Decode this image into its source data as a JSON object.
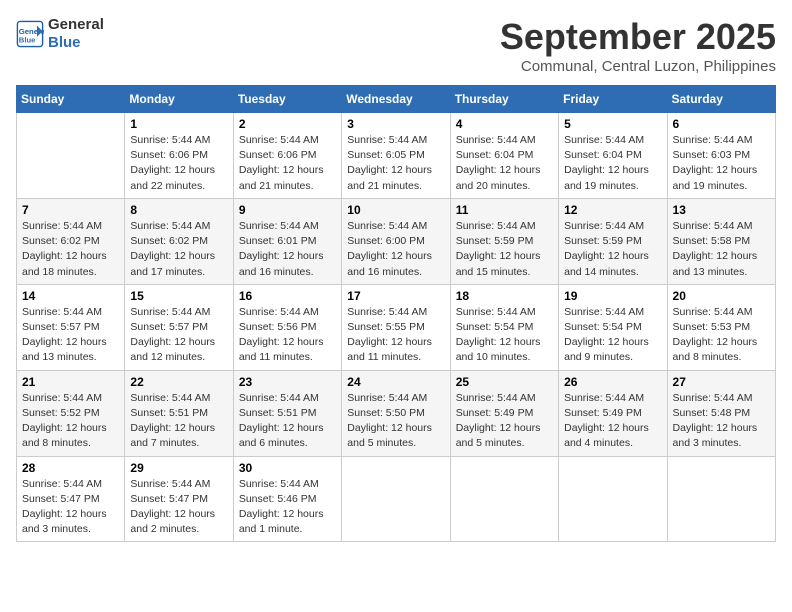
{
  "logo": {
    "text_general": "General",
    "text_blue": "Blue"
  },
  "title": "September 2025",
  "subtitle": "Communal, Central Luzon, Philippines",
  "days_of_week": [
    "Sunday",
    "Monday",
    "Tuesday",
    "Wednesday",
    "Thursday",
    "Friday",
    "Saturday"
  ],
  "weeks": [
    [
      {
        "day": "",
        "info": ""
      },
      {
        "day": "1",
        "info": "Sunrise: 5:44 AM\nSunset: 6:06 PM\nDaylight: 12 hours\nand 22 minutes."
      },
      {
        "day": "2",
        "info": "Sunrise: 5:44 AM\nSunset: 6:06 PM\nDaylight: 12 hours\nand 21 minutes."
      },
      {
        "day": "3",
        "info": "Sunrise: 5:44 AM\nSunset: 6:05 PM\nDaylight: 12 hours\nand 21 minutes."
      },
      {
        "day": "4",
        "info": "Sunrise: 5:44 AM\nSunset: 6:04 PM\nDaylight: 12 hours\nand 20 minutes."
      },
      {
        "day": "5",
        "info": "Sunrise: 5:44 AM\nSunset: 6:04 PM\nDaylight: 12 hours\nand 19 minutes."
      },
      {
        "day": "6",
        "info": "Sunrise: 5:44 AM\nSunset: 6:03 PM\nDaylight: 12 hours\nand 19 minutes."
      }
    ],
    [
      {
        "day": "7",
        "info": "Sunrise: 5:44 AM\nSunset: 6:02 PM\nDaylight: 12 hours\nand 18 minutes."
      },
      {
        "day": "8",
        "info": "Sunrise: 5:44 AM\nSunset: 6:02 PM\nDaylight: 12 hours\nand 17 minutes."
      },
      {
        "day": "9",
        "info": "Sunrise: 5:44 AM\nSunset: 6:01 PM\nDaylight: 12 hours\nand 16 minutes."
      },
      {
        "day": "10",
        "info": "Sunrise: 5:44 AM\nSunset: 6:00 PM\nDaylight: 12 hours\nand 16 minutes."
      },
      {
        "day": "11",
        "info": "Sunrise: 5:44 AM\nSunset: 5:59 PM\nDaylight: 12 hours\nand 15 minutes."
      },
      {
        "day": "12",
        "info": "Sunrise: 5:44 AM\nSunset: 5:59 PM\nDaylight: 12 hours\nand 14 minutes."
      },
      {
        "day": "13",
        "info": "Sunrise: 5:44 AM\nSunset: 5:58 PM\nDaylight: 12 hours\nand 13 minutes."
      }
    ],
    [
      {
        "day": "14",
        "info": "Sunrise: 5:44 AM\nSunset: 5:57 PM\nDaylight: 12 hours\nand 13 minutes."
      },
      {
        "day": "15",
        "info": "Sunrise: 5:44 AM\nSunset: 5:57 PM\nDaylight: 12 hours\nand 12 minutes."
      },
      {
        "day": "16",
        "info": "Sunrise: 5:44 AM\nSunset: 5:56 PM\nDaylight: 12 hours\nand 11 minutes."
      },
      {
        "day": "17",
        "info": "Sunrise: 5:44 AM\nSunset: 5:55 PM\nDaylight: 12 hours\nand 11 minutes."
      },
      {
        "day": "18",
        "info": "Sunrise: 5:44 AM\nSunset: 5:54 PM\nDaylight: 12 hours\nand 10 minutes."
      },
      {
        "day": "19",
        "info": "Sunrise: 5:44 AM\nSunset: 5:54 PM\nDaylight: 12 hours\nand 9 minutes."
      },
      {
        "day": "20",
        "info": "Sunrise: 5:44 AM\nSunset: 5:53 PM\nDaylight: 12 hours\nand 8 minutes."
      }
    ],
    [
      {
        "day": "21",
        "info": "Sunrise: 5:44 AM\nSunset: 5:52 PM\nDaylight: 12 hours\nand 8 minutes."
      },
      {
        "day": "22",
        "info": "Sunrise: 5:44 AM\nSunset: 5:51 PM\nDaylight: 12 hours\nand 7 minutes."
      },
      {
        "day": "23",
        "info": "Sunrise: 5:44 AM\nSunset: 5:51 PM\nDaylight: 12 hours\nand 6 minutes."
      },
      {
        "day": "24",
        "info": "Sunrise: 5:44 AM\nSunset: 5:50 PM\nDaylight: 12 hours\nand 5 minutes."
      },
      {
        "day": "25",
        "info": "Sunrise: 5:44 AM\nSunset: 5:49 PM\nDaylight: 12 hours\nand 5 minutes."
      },
      {
        "day": "26",
        "info": "Sunrise: 5:44 AM\nSunset: 5:49 PM\nDaylight: 12 hours\nand 4 minutes."
      },
      {
        "day": "27",
        "info": "Sunrise: 5:44 AM\nSunset: 5:48 PM\nDaylight: 12 hours\nand 3 minutes."
      }
    ],
    [
      {
        "day": "28",
        "info": "Sunrise: 5:44 AM\nSunset: 5:47 PM\nDaylight: 12 hours\nand 3 minutes."
      },
      {
        "day": "29",
        "info": "Sunrise: 5:44 AM\nSunset: 5:47 PM\nDaylight: 12 hours\nand 2 minutes."
      },
      {
        "day": "30",
        "info": "Sunrise: 5:44 AM\nSunset: 5:46 PM\nDaylight: 12 hours\nand 1 minute."
      },
      {
        "day": "",
        "info": ""
      },
      {
        "day": "",
        "info": ""
      },
      {
        "day": "",
        "info": ""
      },
      {
        "day": "",
        "info": ""
      }
    ]
  ]
}
